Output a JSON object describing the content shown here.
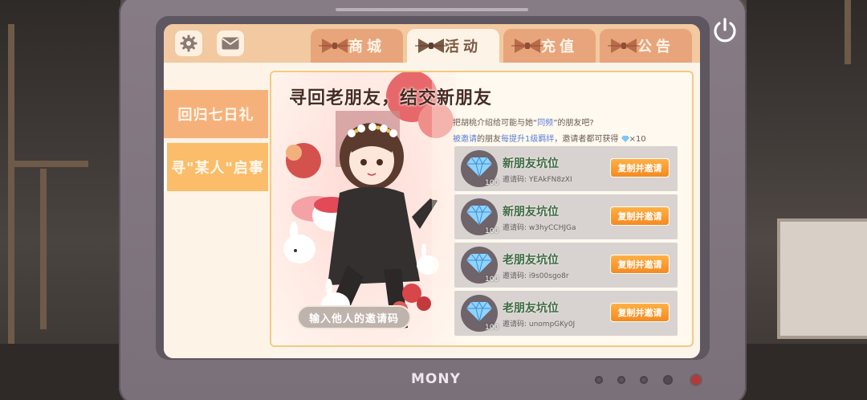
{
  "tv": {
    "brand": "MONY"
  },
  "top": {
    "tabs": [
      {
        "label": "商城",
        "active": false
      },
      {
        "label": "活动",
        "active": true
      },
      {
        "label": "充值",
        "active": false
      },
      {
        "label": "公告",
        "active": false
      }
    ],
    "icons": [
      "gear-icon",
      "mail-icon",
      "power-icon"
    ]
  },
  "sidebar": {
    "items": [
      {
        "label": "回归七日礼"
      },
      {
        "label": "寻\"某人\"启事"
      }
    ]
  },
  "event": {
    "title": "寻回老朋友，结交新朋友",
    "desc_line1_pre": "把胡桃介绍给可能与她“",
    "desc_line1_hl": "同频",
    "desc_line1_post": "”的朋友吧?",
    "desc_line2_hl1": "被邀请",
    "desc_line2_mid1": "的朋友",
    "desc_line2_hl2": "每提升1级羁绊",
    "desc_line2_mid2": "，邀请者都可获得",
    "desc_line2_reward": "×10",
    "slots": [
      {
        "name": "新朋友坑位",
        "code": "邀请码: YEAkFN8zXI",
        "amount": "100",
        "button": "复制并邀请"
      },
      {
        "name": "新朋友坑位",
        "code": "邀请码: w3hyCCHJGa",
        "amount": "100",
        "button": "复制并邀请"
      },
      {
        "name": "老朋友坑位",
        "code": "邀请码: i9s00sgo8r",
        "amount": "100",
        "button": "复制并邀请"
      },
      {
        "name": "老朋友坑位",
        "code": "邀请码: unompGKy0J",
        "amount": "100",
        "button": "复制并邀请"
      }
    ],
    "input_placeholder": "输入他人的邀请码"
  },
  "colors": {
    "accent_orange": "#f58a20",
    "tab_inactive": "#e8a57b",
    "tab_active_bg": "#fdf3e6",
    "gem_blue": "#7cc7f5",
    "slot_name_green": "#3d6a40"
  }
}
